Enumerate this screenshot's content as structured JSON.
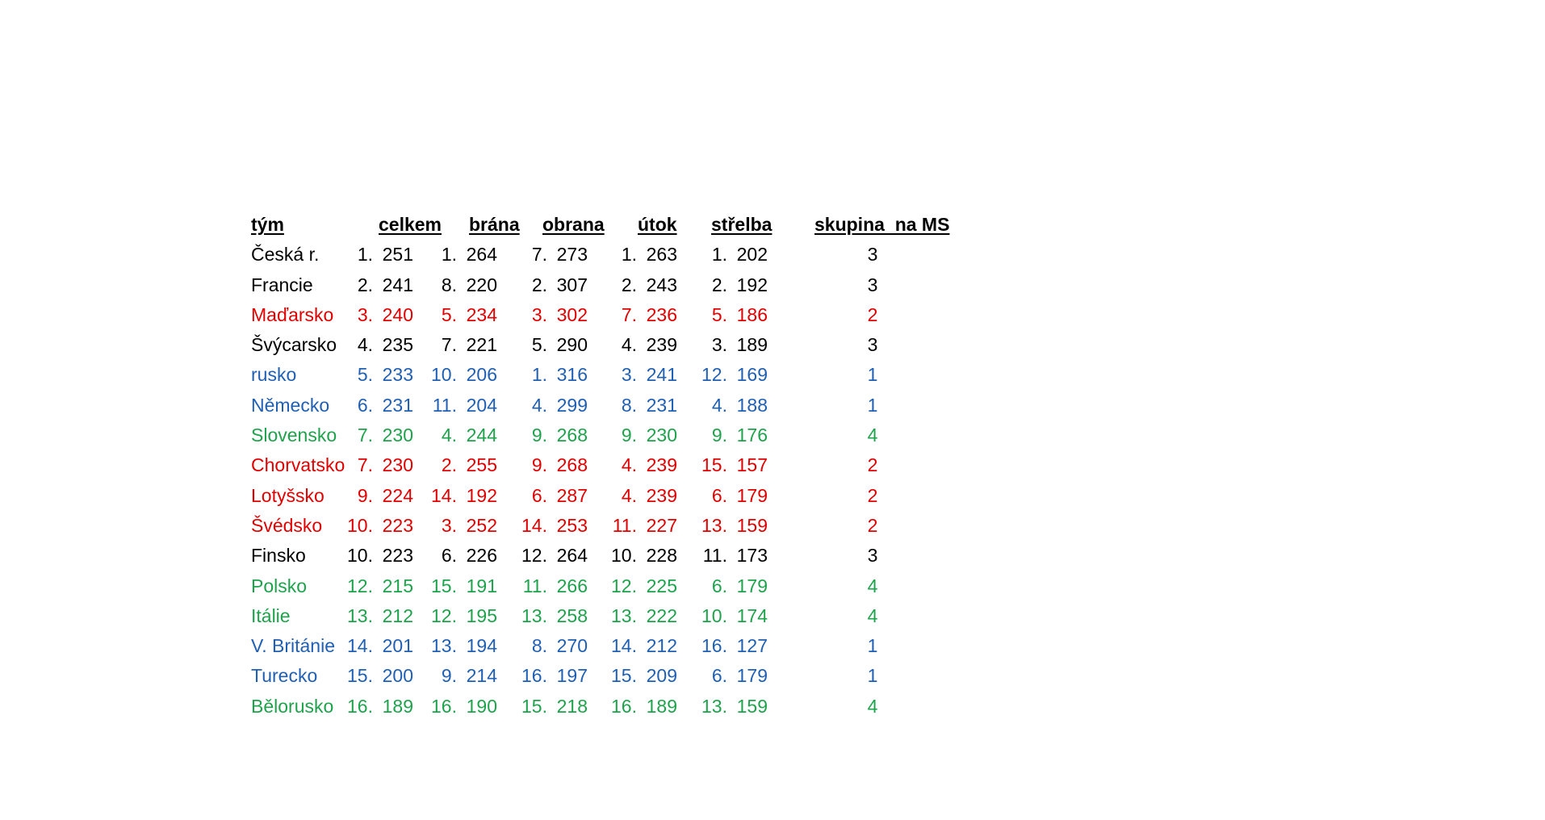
{
  "colors": {
    "black": "#000000",
    "red": "#e00000",
    "blue": "#1f5fb4",
    "green": "#1ea34c"
  },
  "headers": {
    "team": "tým",
    "total": "celkem",
    "goal": "brána",
    "defense": "obrana",
    "attack": "útok",
    "shooting": "střelba",
    "group": "skupina  na MS"
  },
  "rows": [
    {
      "team": "Česká r.",
      "color": "black",
      "total": [
        "1.",
        "251"
      ],
      "goal": [
        "1.",
        "264"
      ],
      "defense": [
        "7.",
        "273"
      ],
      "attack": [
        "1.",
        "263"
      ],
      "shooting": [
        "1.",
        "202"
      ],
      "group": "3"
    },
    {
      "team": "Francie",
      "color": "black",
      "total": [
        "2.",
        "241"
      ],
      "goal": [
        "8.",
        "220"
      ],
      "defense": [
        "2.",
        "307"
      ],
      "attack": [
        "2.",
        "243"
      ],
      "shooting": [
        "2.",
        "192"
      ],
      "group": "3"
    },
    {
      "team": "Maďarsko",
      "color": "red",
      "total": [
        "3.",
        "240"
      ],
      "goal": [
        "5.",
        "234"
      ],
      "defense": [
        "3.",
        "302"
      ],
      "attack": [
        "7.",
        "236"
      ],
      "shooting": [
        "5.",
        "186"
      ],
      "group": "2"
    },
    {
      "team": "Švýcarsko",
      "color": "black",
      "total": [
        "4.",
        "235"
      ],
      "goal": [
        "7.",
        "221"
      ],
      "defense": [
        "5.",
        "290"
      ],
      "attack": [
        "4.",
        "239"
      ],
      "shooting": [
        "3.",
        "189"
      ],
      "group": "3"
    },
    {
      "team": "rusko",
      "color": "blue",
      "total": [
        "5.",
        "233"
      ],
      "goal": [
        "10.",
        "206"
      ],
      "defense": [
        "1.",
        "316"
      ],
      "attack": [
        "3.",
        "241"
      ],
      "shooting": [
        "12.",
        "169"
      ],
      "group": "1"
    },
    {
      "team": "Německo",
      "color": "blue",
      "total": [
        "6.",
        "231"
      ],
      "goal": [
        "11.",
        "204"
      ],
      "defense": [
        "4.",
        "299"
      ],
      "attack": [
        "8.",
        "231"
      ],
      "shooting": [
        "4.",
        "188"
      ],
      "group": "1"
    },
    {
      "team": "Slovensko",
      "color": "green",
      "total": [
        "7.",
        "230"
      ],
      "goal": [
        "4.",
        "244"
      ],
      "defense": [
        "9.",
        "268"
      ],
      "attack": [
        "9.",
        "230"
      ],
      "shooting": [
        "9.",
        "176"
      ],
      "group": "4"
    },
    {
      "team": "Chorvatsko",
      "color": "red",
      "total": [
        "7.",
        "230"
      ],
      "goal": [
        "2.",
        "255"
      ],
      "defense": [
        "9.",
        "268"
      ],
      "attack": [
        "4.",
        "239"
      ],
      "shooting": [
        "15.",
        "157"
      ],
      "group": "2"
    },
    {
      "team": "Lotyšsko",
      "color": "red",
      "total": [
        "9.",
        "224"
      ],
      "goal": [
        "14.",
        "192"
      ],
      "defense": [
        "6.",
        "287"
      ],
      "attack": [
        "4.",
        "239"
      ],
      "shooting": [
        "6.",
        "179"
      ],
      "group": "2"
    },
    {
      "team": "Švédsko",
      "color": "red",
      "total": [
        "10.",
        "223"
      ],
      "goal": [
        "3.",
        "252"
      ],
      "defense": [
        "14.",
        "253"
      ],
      "attack": [
        "11.",
        "227"
      ],
      "shooting": [
        "13.",
        "159"
      ],
      "group": "2"
    },
    {
      "team": "Finsko",
      "color": "black",
      "total": [
        "10.",
        "223"
      ],
      "goal": [
        "6.",
        "226"
      ],
      "defense": [
        "12.",
        "264"
      ],
      "attack": [
        "10.",
        "228"
      ],
      "shooting": [
        "11.",
        "173"
      ],
      "group": "3"
    },
    {
      "team": "Polsko",
      "color": "green",
      "total": [
        "12.",
        "215"
      ],
      "goal": [
        "15.",
        "191"
      ],
      "defense": [
        "11.",
        "266"
      ],
      "attack": [
        "12.",
        "225"
      ],
      "shooting": [
        "6.",
        "179"
      ],
      "group": "4"
    },
    {
      "team": "Itálie",
      "color": "green",
      "total": [
        "13.",
        "212"
      ],
      "goal": [
        "12.",
        "195"
      ],
      "defense": [
        "13.",
        "258"
      ],
      "attack": [
        "13.",
        "222"
      ],
      "shooting": [
        "10.",
        "174"
      ],
      "group": "4"
    },
    {
      "team": "V. Británie",
      "color": "blue",
      "total": [
        "14.",
        "201"
      ],
      "goal": [
        "13.",
        "194"
      ],
      "defense": [
        "8.",
        "270"
      ],
      "attack": [
        "14.",
        "212"
      ],
      "shooting": [
        "16.",
        "127"
      ],
      "group": "1"
    },
    {
      "team": "Turecko",
      "color": "blue",
      "total": [
        "15.",
        "200"
      ],
      "goal": [
        "9.",
        "214"
      ],
      "defense": [
        "16.",
        "197"
      ],
      "attack": [
        "15.",
        "209"
      ],
      "shooting": [
        "6.",
        "179"
      ],
      "group": "1"
    },
    {
      "team": "Bělorusko",
      "color": "green",
      "total": [
        "16.",
        "189"
      ],
      "goal": [
        "16.",
        "190"
      ],
      "defense": [
        "15.",
        "218"
      ],
      "attack": [
        "16.",
        "189"
      ],
      "shooting": [
        "13.",
        "159"
      ],
      "group": "4"
    }
  ]
}
